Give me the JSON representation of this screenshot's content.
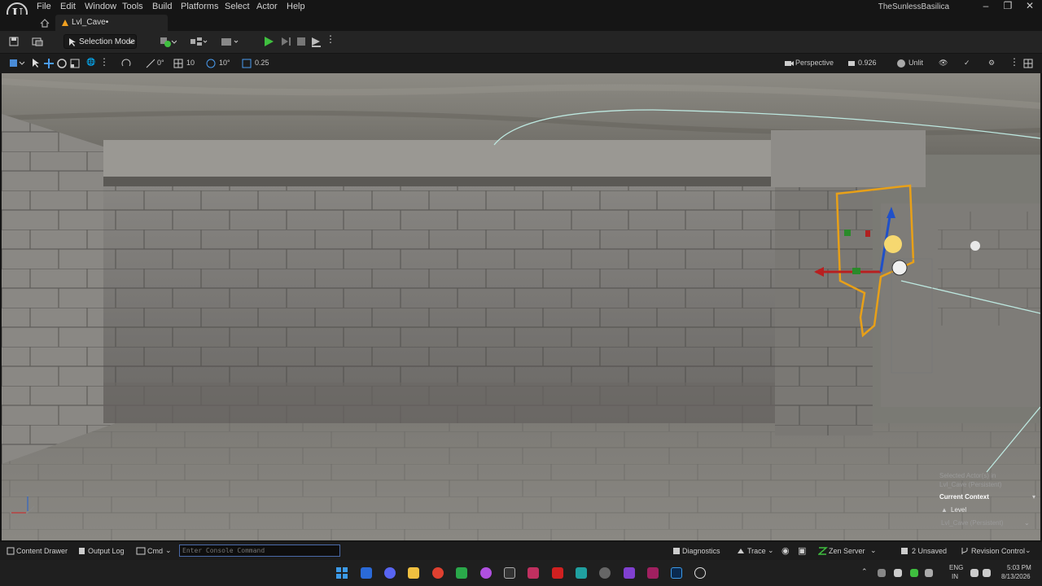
{
  "menu": [
    "File",
    "Edit",
    "Window",
    "Tools",
    "Build",
    "Platforms",
    "Select",
    "Actor",
    "Help"
  ],
  "project_name": "TheSunlessBasilica",
  "level_tab": "Lvl_Cave•",
  "toolbar": {
    "mode": "Selection Mode"
  },
  "viewport_toolbar": {
    "rotate_snap_value": "0°",
    "grid_value": "10",
    "angle_value": "10°",
    "scale_value": "0.25",
    "view_mode": "Perspective",
    "camera_speed": "0.926",
    "lighting": "Unlit"
  },
  "context_panel": {
    "selected_line1": "Selected Actor(s) in",
    "selected_line2": "Lvl_Cave (Persistent)",
    "header": "Current Context",
    "level_label": "Level",
    "level_value": "Lvl_Cave (Persistent)"
  },
  "bottom_bar": {
    "content_drawer": "Content Drawer",
    "output_log": "Output Log",
    "cmd": "Cmd",
    "console_placeholder": "Enter Console Command",
    "diagnostics": "Diagnostics",
    "trace": "Trace",
    "zen_server": "Zen Server",
    "unsaved": "2 Unsaved",
    "revision_control": "Revision Control"
  },
  "taskbar": {
    "lang1": "ENG",
    "lang2": "IN",
    "time": "5:03 PM",
    "date": "8/13/2026"
  },
  "colors": {
    "accent": "#f0a020",
    "play": "#3fbf3f",
    "selection": "#e8a018"
  }
}
